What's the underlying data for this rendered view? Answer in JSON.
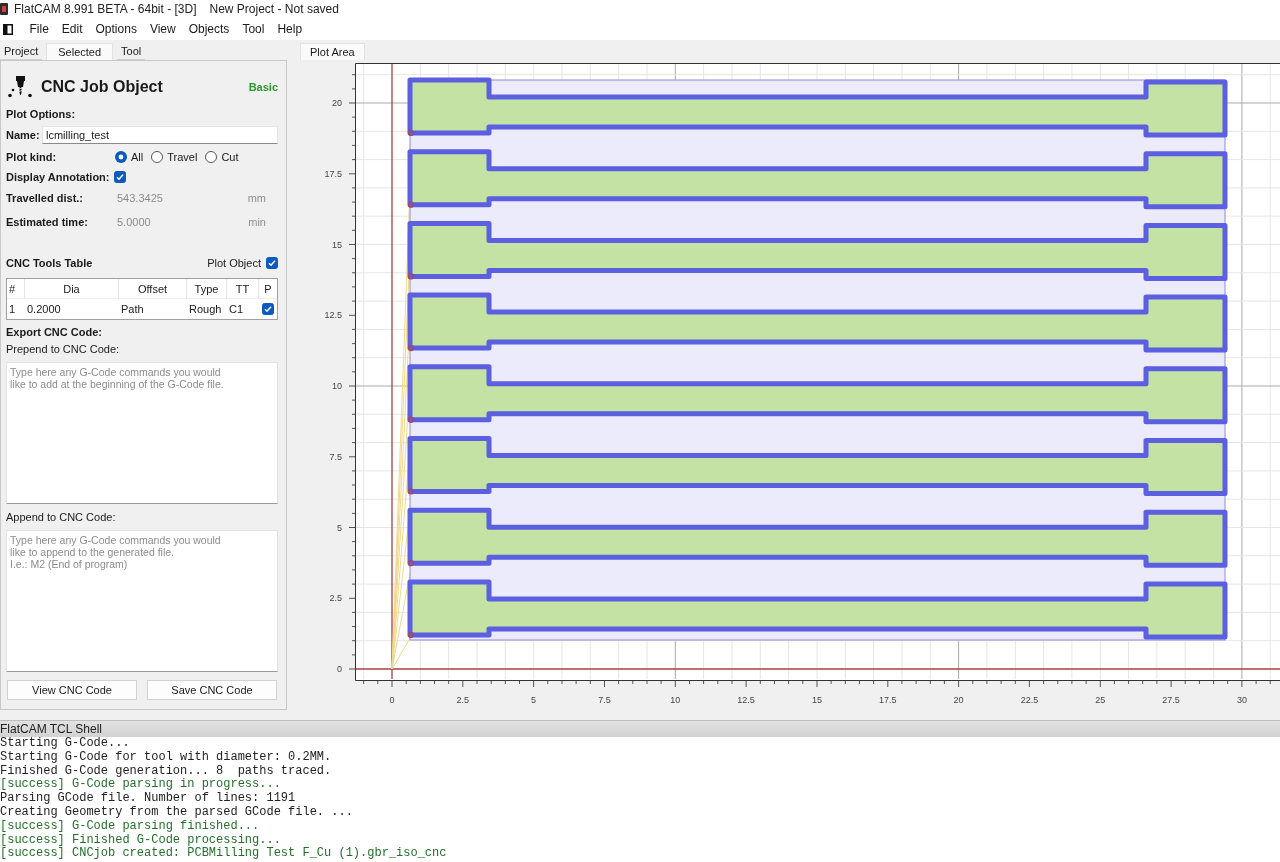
{
  "window": {
    "title": "FlatCAM 8.991 BETA - 64bit - [3D]",
    "project": "New Project - Not saved"
  },
  "menu": [
    "File",
    "Edit",
    "Options",
    "View",
    "Objects",
    "Tool",
    "Help"
  ],
  "left_tabs": [
    {
      "label": "Project",
      "selected": false
    },
    {
      "label": "Selected",
      "selected": true
    },
    {
      "label": "Tool",
      "selected": false
    }
  ],
  "object_panel": {
    "title": "CNC Job Object",
    "mode": "Basic",
    "plot_options_heading": "Plot Options:",
    "name": {
      "label": "Name:",
      "value": "lcmilling_test"
    },
    "plot_kind": {
      "label": "Plot kind:",
      "options": [
        {
          "label": "All",
          "selected": true
        },
        {
          "label": "Travel",
          "selected": false
        },
        {
          "label": "Cut",
          "selected": false
        }
      ]
    },
    "display_annotation": {
      "label": "Display Annotation:",
      "checked": true
    },
    "readouts": [
      {
        "label": "Travelled dist.:",
        "value": "543.3425",
        "unit": "mm"
      },
      {
        "label": "Estimated time:",
        "value": "5.0000",
        "unit": "min"
      }
    ],
    "tools_table": {
      "title": "CNC Tools Table",
      "plot_object": {
        "label": "Plot Object",
        "checked": true
      },
      "columns": [
        "#",
        "Dia",
        "Offset",
        "Type",
        "TT",
        "P"
      ],
      "rows": [
        {
          "cells": [
            "1",
            "0.2000",
            "Path",
            "Rough",
            "C1"
          ],
          "checked": true
        }
      ]
    },
    "export_heading": "Export CNC Code:",
    "prepend": {
      "label": "Prepend to CNC Code:",
      "placeholder": "Type here any G-Code commands you would\nlike to add at the beginning of the G-Code file."
    },
    "append": {
      "label": "Append to CNC Code:",
      "placeholder": "Type here any G-Code commands you would\nlike to append to the generated file.\nI.e.: M2 (End of program)"
    },
    "buttons": [
      "View CNC Code",
      "Save CNC Code"
    ]
  },
  "plot_tabs": [
    {
      "label": "Plot Area",
      "selected": true
    }
  ],
  "plot": {
    "y_axis_labels": [
      "20",
      "17.5",
      "15",
      "12.5",
      "10",
      "7.5",
      "5",
      "2.5",
      "0"
    ],
    "x_axis_labels": [
      "0",
      "2.5",
      "5",
      "7.5",
      "10",
      "12.5",
      "15",
      "17.5",
      "20",
      "22.5",
      "25",
      "27.5",
      "30"
    ]
  },
  "shell": {
    "title": "FlatCAM TCL Shell",
    "lines": [
      {
        "kind": "info",
        "text": "Starting G-Code..."
      },
      {
        "kind": "info",
        "text": "Starting G-Code for tool with diameter: 0.2MM."
      },
      {
        "kind": "info",
        "text": "Finished G-Code generation... 8  paths traced."
      },
      {
        "kind": "success",
        "text": "[success] G-Code parsing in progress..."
      },
      {
        "kind": "info",
        "text": "Parsing GCode file. Number of lines: 1191"
      },
      {
        "kind": "info",
        "text": "Creating Geometry from the parsed GCode file. ..."
      },
      {
        "kind": "success",
        "text": "[success] G-Code parsing finished..."
      },
      {
        "kind": "success",
        "text": "[success] Finished G-Code processing..."
      },
      {
        "kind": "success",
        "text": "[success] CNCjob created: PCBMilling Test F_Cu (1).gbr_iso_cnc"
      }
    ]
  }
}
